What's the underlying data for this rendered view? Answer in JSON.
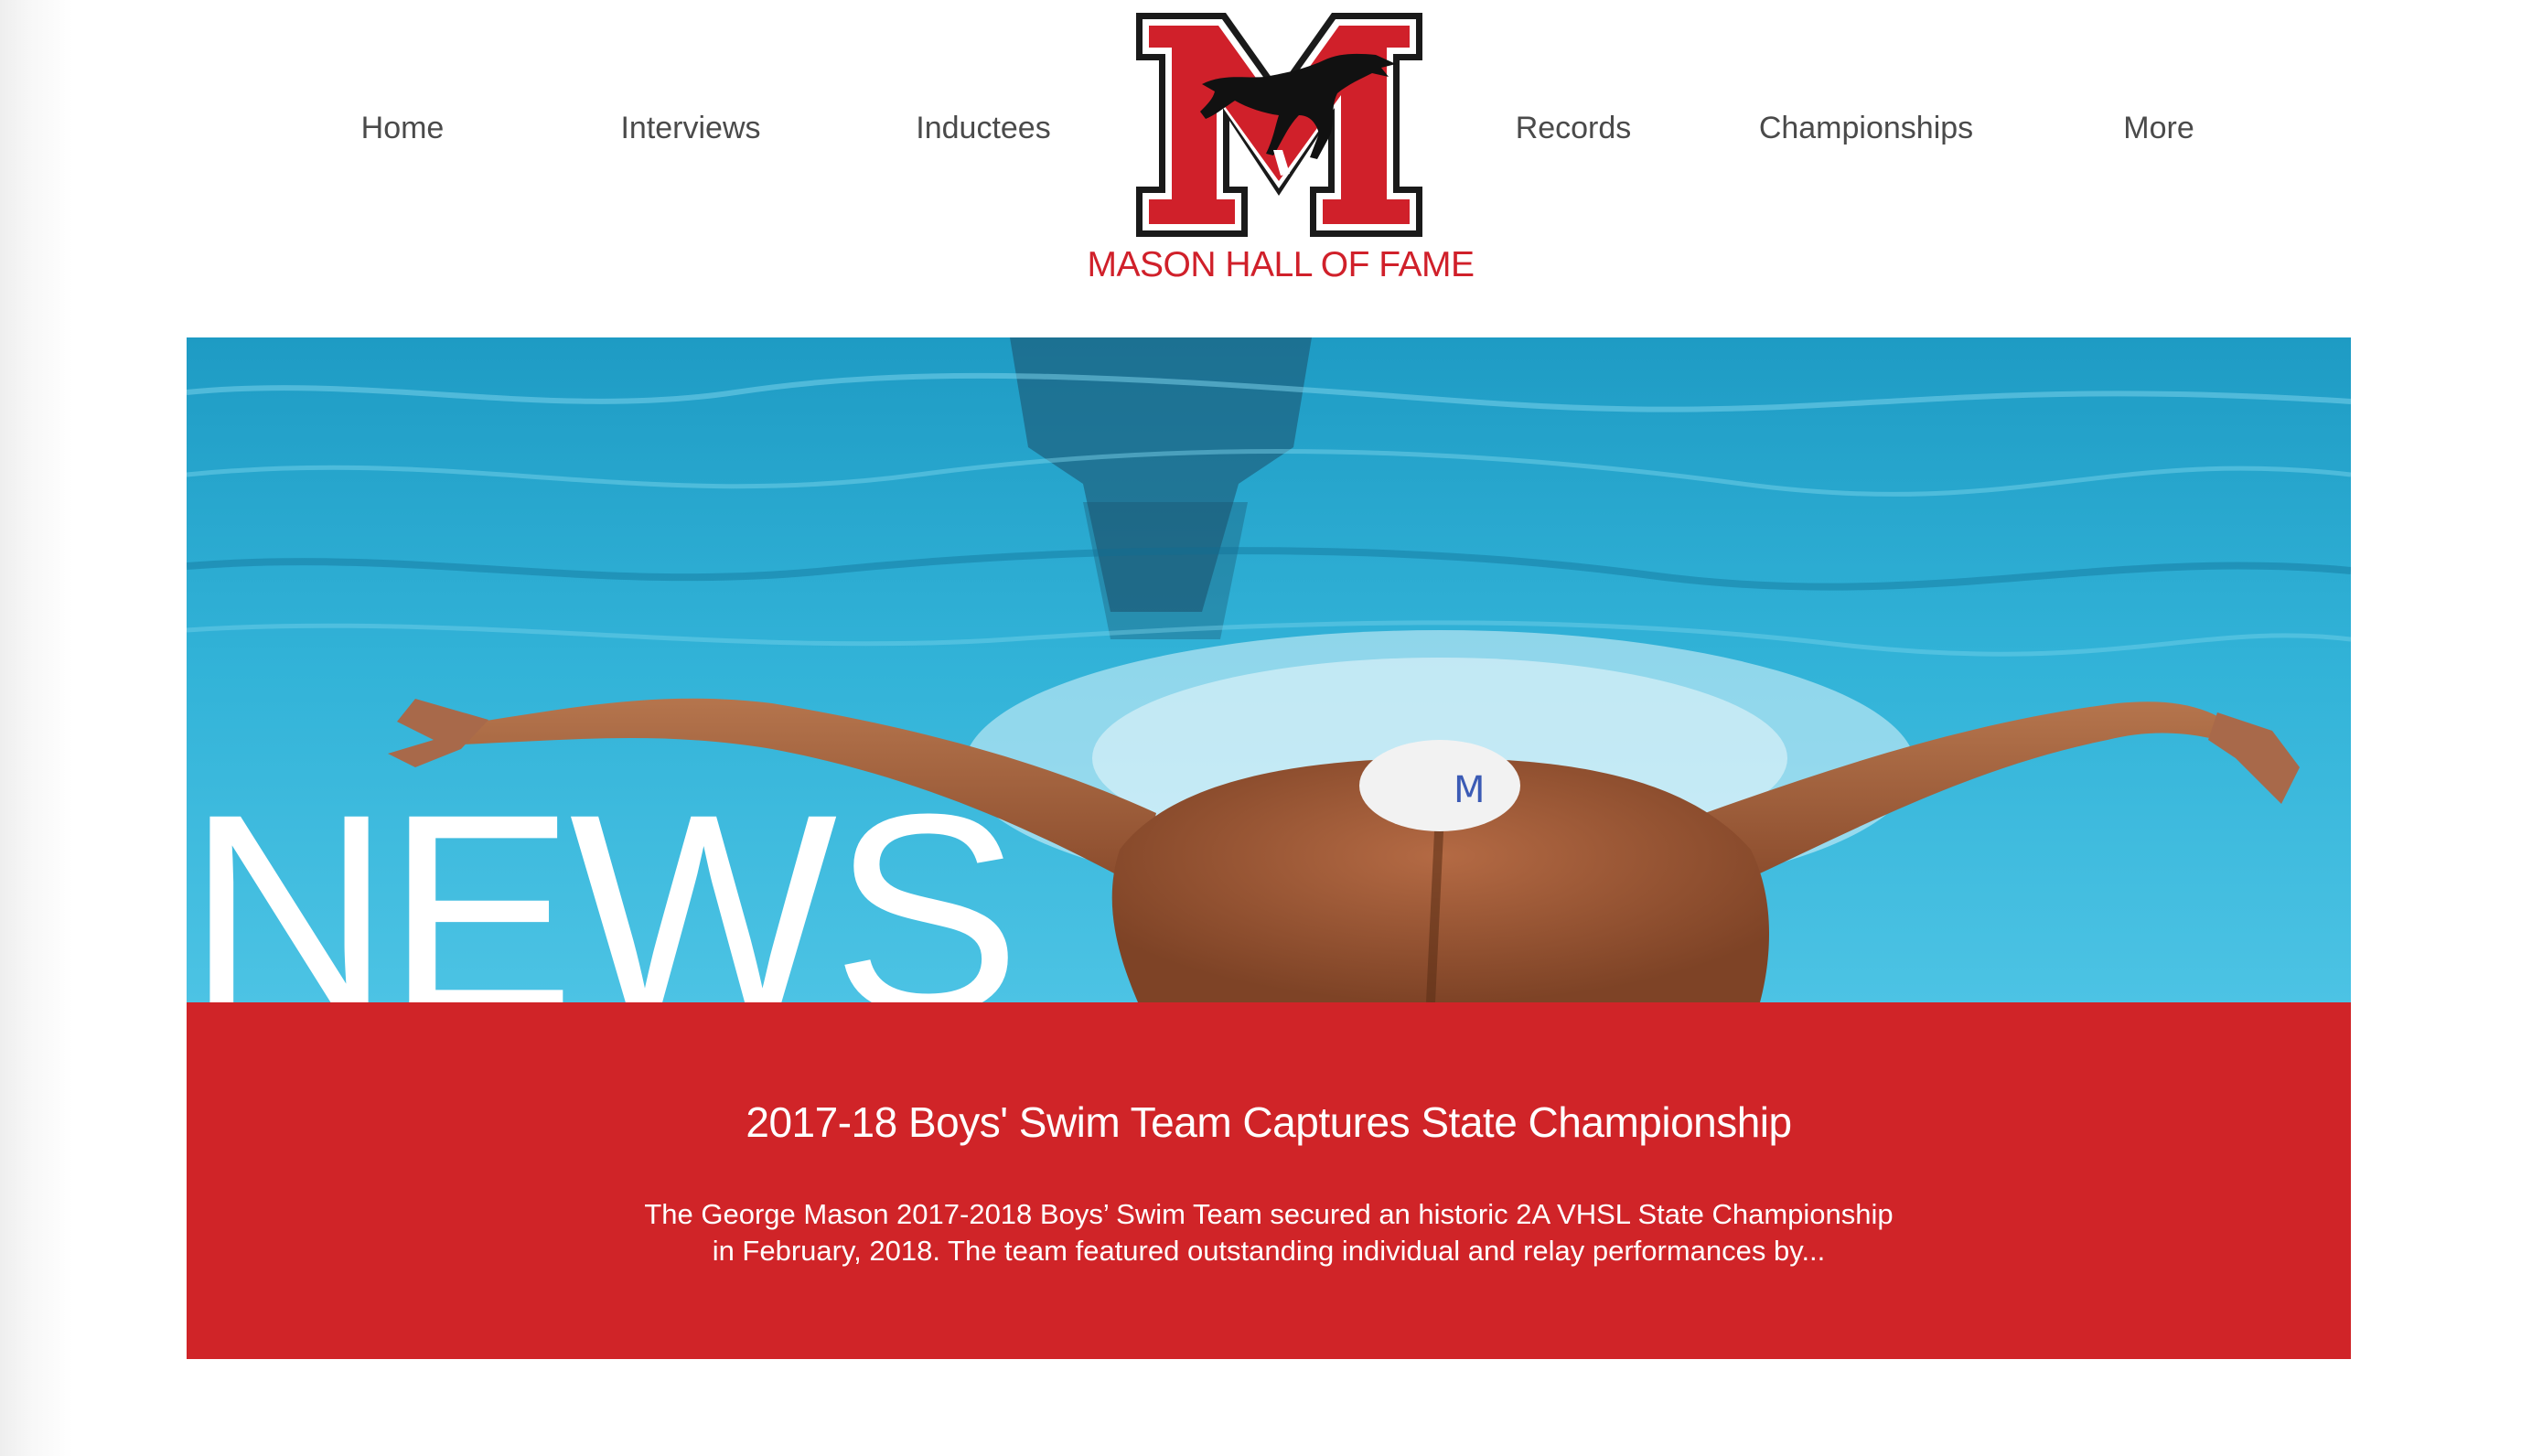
{
  "nav": {
    "home": "Home",
    "interviews": "Interviews",
    "inductees": "Inductees",
    "records": "Records",
    "championships": "Championships",
    "more": "More"
  },
  "site": {
    "title": "MASON HALL OF FAME",
    "logo_letter": "M",
    "logo_icon": "mustang-icon"
  },
  "hero": {
    "word": "NEWS",
    "image": "swimmer-butterfly-photo"
  },
  "news": {
    "title": "2017-18 Boys' Swim Team Captures State Championship",
    "excerpt_line1": "The George Mason 2017-2018 Boys’ Swim Team secured an historic 2A VHSL State Championship",
    "excerpt_line2": "in February, 2018. The team featured outstanding individual and relay performances by..."
  },
  "colors": {
    "brand_red": "#d0202a",
    "card_red": "#d02428",
    "pool_blue": "#2aa7cf",
    "nav_text": "#4a4a4a"
  }
}
